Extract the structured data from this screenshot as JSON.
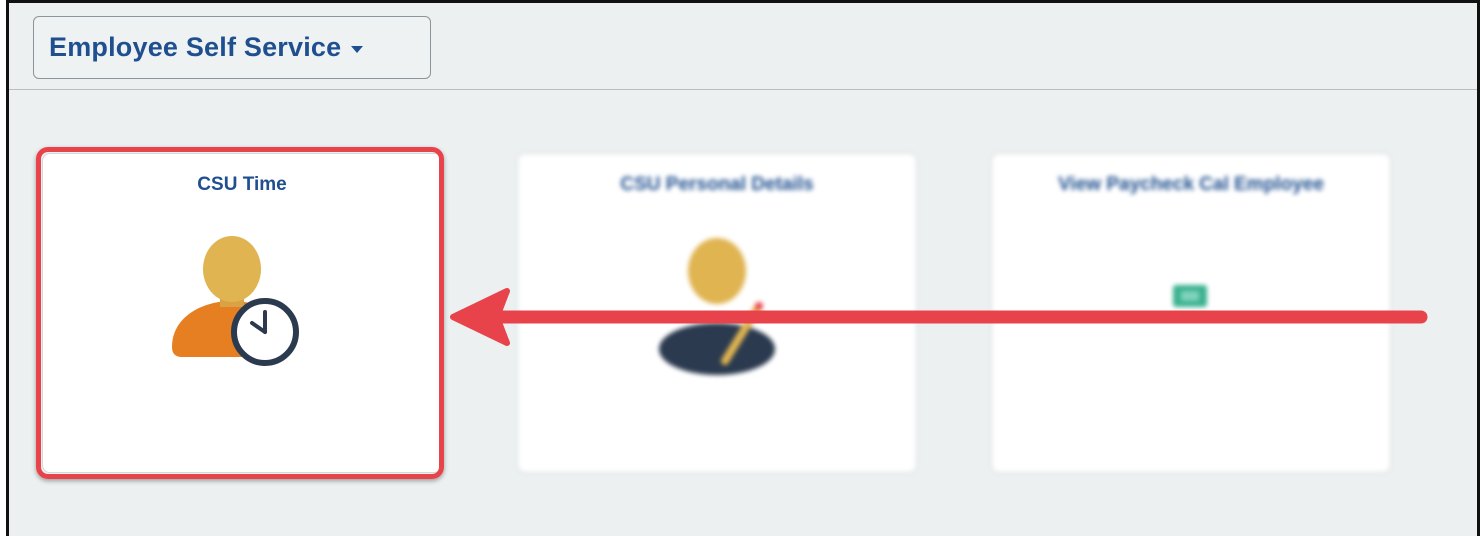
{
  "header": {
    "homepage_title": "Employee Self Service"
  },
  "tiles": [
    {
      "title": "CSU Time",
      "icon": "person-clock-icon"
    },
    {
      "title": "CSU Personal Details",
      "icon": "person-edit-icon"
    },
    {
      "title": "View Paycheck Cal Employee",
      "icon": "paycheck-icon"
    }
  ],
  "colors": {
    "title_blue": "#1f4f8f",
    "page_background": "#ecf0f1",
    "callout_red": "#e8424a",
    "person_head": "#e0b451",
    "person_body_orange": "#e57f22",
    "person_body_navy": "#2b3a4f",
    "clock_stroke": "#2b3a4f",
    "paycheck_green": "#3bb08f"
  },
  "annotation": {
    "type": "arrow",
    "points_to": "CSU Time"
  }
}
